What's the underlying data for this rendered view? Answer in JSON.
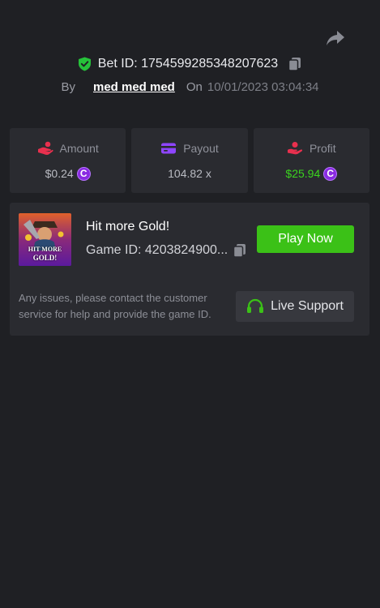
{
  "bet": {
    "label": "Bet ID: 1754599285348207623",
    "by_label": "By",
    "username": "med med med",
    "on_label": "On",
    "datetime": "10/01/2023 03:04:34"
  },
  "stats": {
    "amount": {
      "label": "Amount",
      "value": "$0.24"
    },
    "payout": {
      "label": "Payout",
      "value": "104.82 x"
    },
    "profit": {
      "label": "Profit",
      "value": "$25.94"
    },
    "coin_symbol": "C"
  },
  "game": {
    "title": "Hit more Gold!",
    "id_text": "Game ID: 4203824900...",
    "play_label": "Play Now",
    "thumb_text_line1": "HIT MORE",
    "thumb_text_line2": "GOLD!"
  },
  "support": {
    "help_text": "Any issues, please contact the customer service for help and provide the game ID.",
    "button_label": "Live Support"
  },
  "colors": {
    "background": "#1f2024",
    "card": "#2a2b30",
    "accent_green": "#3bc117",
    "profit_green": "#3bd41f",
    "coin_purple": "#8a2be2"
  },
  "icons": {
    "share": "share-icon",
    "shield": "shield-check-icon",
    "copy": "copy-icon",
    "amount": "hand-coins-icon",
    "payout": "card-icon",
    "profit": "hand-money-icon",
    "support": "headset-icon"
  }
}
